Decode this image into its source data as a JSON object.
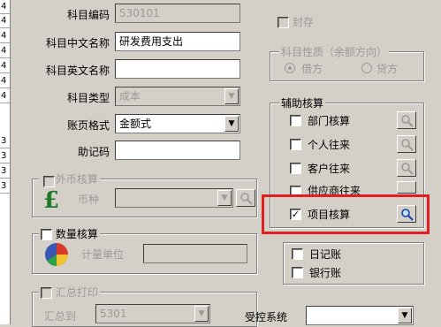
{
  "edge_rows": [
    "4",
    "4",
    "4",
    "4",
    "4",
    "4",
    "4",
    "3",
    "3",
    "3",
    "3"
  ],
  "account": {
    "code_label": "科目编码",
    "code_value": "530101",
    "cn_name_label": "科目中文名称",
    "cn_name_value": "研发费用支出",
    "en_name_label": "科目英文名称",
    "en_name_value": "",
    "type_label": "科目类型",
    "type_value": "成本",
    "page_format_label": "账页格式",
    "page_format_value": "金额式",
    "mnemonic_label": "助记码",
    "mnemonic_value": ""
  },
  "foreign": {
    "title": "外币核算",
    "currency_label": "币种",
    "currency_value": ""
  },
  "quantity": {
    "title": "数量核算",
    "unit_label": "计量单位",
    "unit_value": ""
  },
  "summary_print": {
    "title": "汇总打印",
    "to_label": "汇总到",
    "to_value": "5301"
  },
  "sealed_label": "封存",
  "nature": {
    "title": "科目性质（余额方向）",
    "debit": "借方",
    "credit": "贷方"
  },
  "aux": {
    "title": "辅助核算",
    "items": [
      {
        "label": "部门核算",
        "checked": false
      },
      {
        "label": "个人往来",
        "checked": false
      },
      {
        "label": "客户往来",
        "checked": false
      },
      {
        "label": "供应商往来",
        "checked": false
      },
      {
        "label": "项目核算",
        "checked": true
      }
    ]
  },
  "journal_label": "日记账",
  "bank_label": "银行账",
  "controlled_label": "受控系统",
  "controlled_value": "",
  "colors": {
    "highlight": "#e02020",
    "window": "#d4d0c8"
  }
}
